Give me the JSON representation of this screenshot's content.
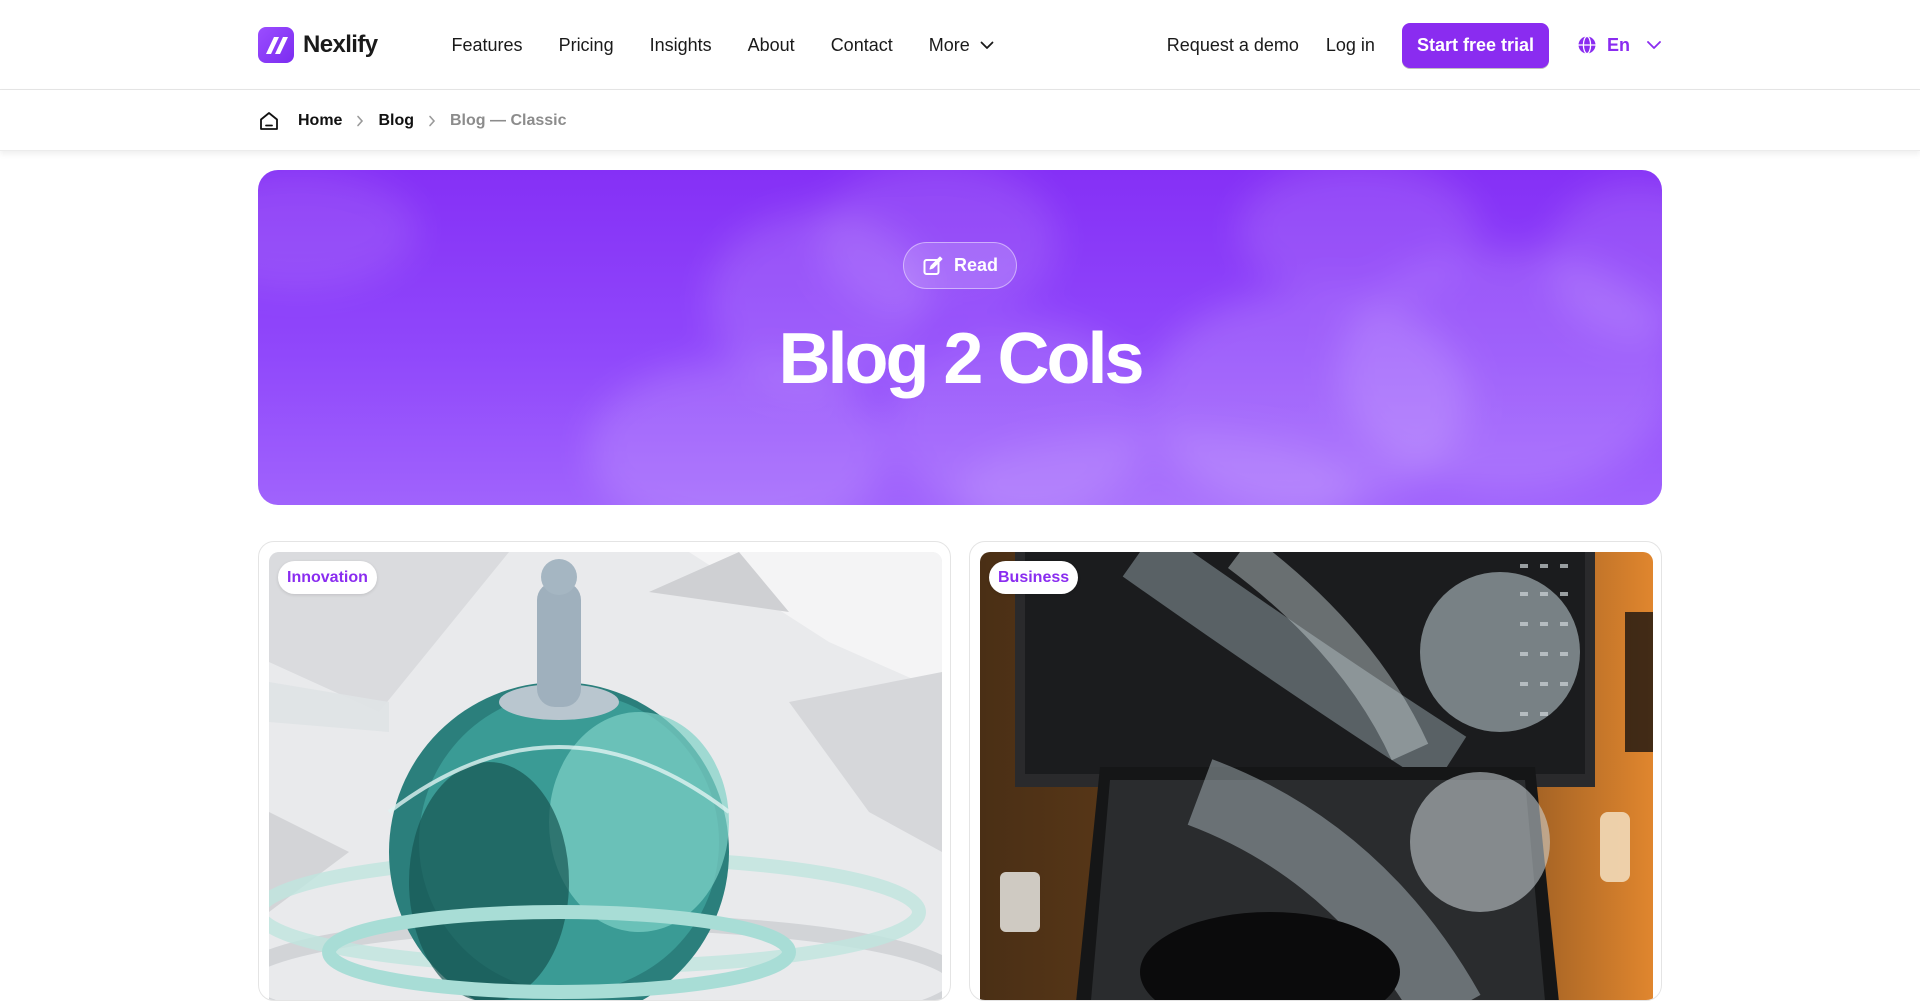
{
  "brand": {
    "name": "Nexlify",
    "accent": "#8a2cf0"
  },
  "nav": {
    "items": [
      {
        "label": "Features"
      },
      {
        "label": "Pricing"
      },
      {
        "label": "Insights"
      },
      {
        "label": "About"
      },
      {
        "label": "Contact"
      },
      {
        "label": "More",
        "icon": "chevron-down-icon"
      }
    ]
  },
  "header_actions": {
    "demo_label": "Request a demo",
    "login_label": "Log in",
    "trial_label": "Start free trial",
    "language": "En",
    "language_icon": "globe-icon"
  },
  "breadcrumb": {
    "home_icon": "home-icon",
    "items": [
      {
        "label": "Home"
      },
      {
        "label": "Blog"
      },
      {
        "label": "Blog — Classic"
      }
    ]
  },
  "hero": {
    "badge_icon": "edit-icon",
    "badge_label": "Read",
    "title": "Blog 2 Cols"
  },
  "posts": [
    {
      "category": "Innovation"
    },
    {
      "category": "Business"
    }
  ]
}
